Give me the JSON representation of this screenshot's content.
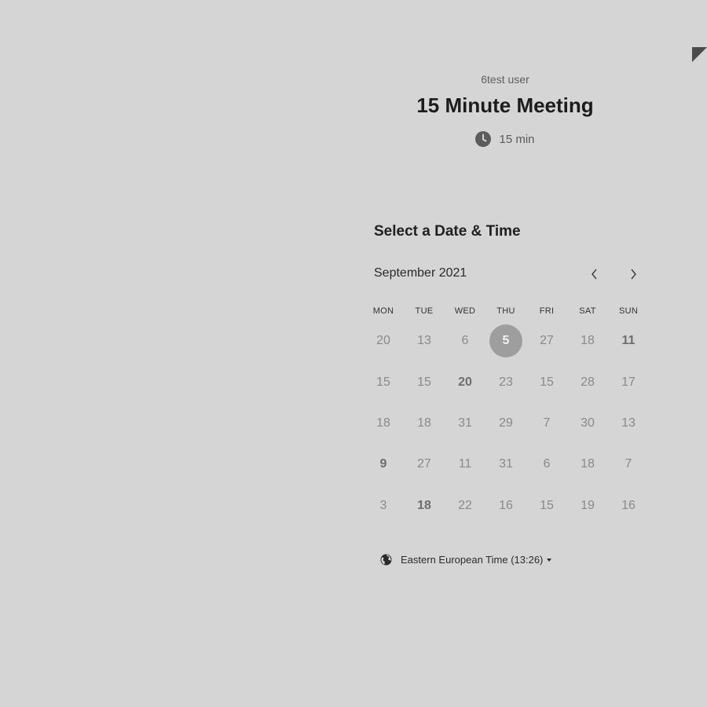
{
  "event": {
    "organizer": "6test user",
    "title": "15 Minute Meeting",
    "duration": "15 min",
    "duration_icon": "clock-icon"
  },
  "picker": {
    "title": "Select a Date & Time",
    "month": "September 2021",
    "prev_icon": "chevron-left-icon",
    "next_icon": "chevron-right-icon",
    "weekdays": [
      "MON",
      "TUE",
      "WED",
      "THU",
      "FRI",
      "SAT",
      "SUN"
    ],
    "weeks": [
      [
        "20",
        "13",
        "6",
        "5",
        "27",
        "18",
        "11"
      ],
      [
        "15",
        "15",
        "20",
        "23",
        "15",
        "28",
        "17"
      ],
      [
        "18",
        "18",
        "31",
        "29",
        "7",
        "30",
        "13"
      ],
      [
        "9",
        "27",
        "11",
        "31",
        "6",
        "18",
        "7"
      ],
      [
        "3",
        "18",
        "22",
        "16",
        "15",
        "19",
        "16"
      ]
    ],
    "bold_days": [
      [
        0,
        6
      ],
      [
        1,
        2
      ],
      [
        3,
        0
      ],
      [
        4,
        1
      ]
    ],
    "selected_day": [
      0,
      3
    ]
  },
  "timezone": {
    "label": "Eastern European Time (13:26)",
    "icon": "globe-icon"
  }
}
